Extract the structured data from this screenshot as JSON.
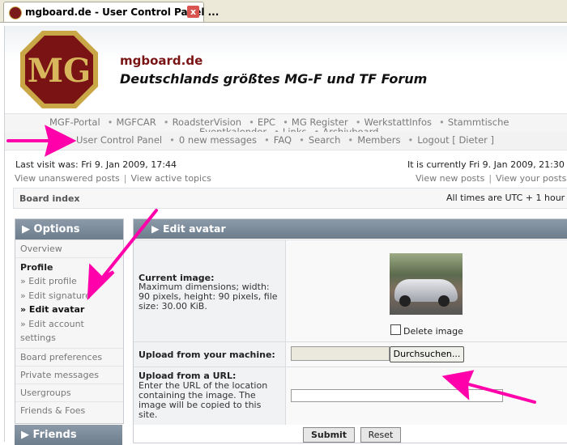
{
  "browser": {
    "tab_title": "mgboard.de - User Control Panel ...",
    "close_label": "x"
  },
  "header": {
    "logo_text": "MG",
    "site_title": "mgboard.de",
    "site_desc": "Deutschlands größtes MG-F und TF Forum"
  },
  "nav_top": [
    "MGF-Portal",
    "MGFCAR",
    "RoadsterVision",
    "EPC",
    "MG Register",
    "WerkstattInfos",
    "Stammtische"
  ],
  "nav_top_line2": [
    "Eventkalender",
    "Links",
    "Archivboard"
  ],
  "nav_bottom": [
    "User Control Panel",
    "0 new messages",
    "FAQ",
    "Search",
    "Members",
    "Logout [ Dieter ]"
  ],
  "info": {
    "last_visit": "Last visit was: Fri 9. Jan 2009, 17:44",
    "unanswered": "View unanswered posts",
    "active": "View active topics",
    "current_time": "It is currently Fri 9. Jan 2009, 21:30",
    "new_posts": "View new posts",
    "your_posts": "View your posts"
  },
  "breadcrumb": {
    "left": "Board index",
    "right": "All times are UTC + 1 hour"
  },
  "sidebar": {
    "title": "Options",
    "overview": "Overview",
    "profile_title": "Profile",
    "profile_items": [
      "» Edit profile",
      "» Edit signature",
      "» Edit avatar",
      "» Edit account settings"
    ],
    "items": [
      "Board preferences",
      "Private messages",
      "Usergroups",
      "Friends & Foes"
    ],
    "friends_title": "Friends"
  },
  "panel": {
    "title": "Edit avatar",
    "current_image_label": "Current image:",
    "current_image_explain": "Maximum dimensions; width: 90 pixels, height: 90 pixels, file size: 30.00 KiB.",
    "delete_label": "Delete image",
    "upload_label": "Upload from your machine:",
    "browse_label": "Durchsuchen...",
    "url_label": "Upload from a URL:",
    "url_explain": "Enter the URL of the location containing the image. The image will be copied to this site."
  },
  "buttons": {
    "submit": "Submit",
    "reset": "Reset"
  },
  "colors": {
    "arrow": "#ff00aa",
    "header_bar": "#7d8b99",
    "site_title": "#7a1414"
  }
}
